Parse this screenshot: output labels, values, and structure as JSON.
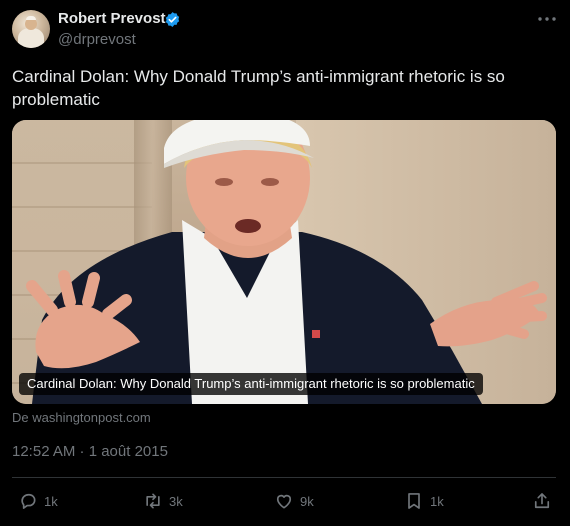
{
  "author": {
    "name": "Robert Prevost",
    "handle": "@drprevost",
    "verified": true
  },
  "tweet": {
    "text": "Cardinal Dolan: Why Donald Trump’s anti-immigrant rhetoric is so problematic"
  },
  "card": {
    "caption": "Cardinal Dolan: Why Donald Trump’s anti-immigrant rhetoric is so problematic",
    "source": "De washingtonpost.com"
  },
  "timestamp": "12:52 AM · 1 août 2015",
  "actions": {
    "replies": "1k",
    "retweets": "3k",
    "likes": "9k",
    "bookmarks": "1k"
  },
  "icons": {
    "verified": "verified-badge-icon",
    "more": "more-icon",
    "reply": "reply-icon",
    "retweet": "retweet-icon",
    "like": "heart-icon",
    "bookmark": "bookmark-icon",
    "share": "share-icon"
  },
  "colors": {
    "background": "#000000",
    "text": "#e7e9ea",
    "muted": "#71767b",
    "verified": "#1d9bf0"
  }
}
